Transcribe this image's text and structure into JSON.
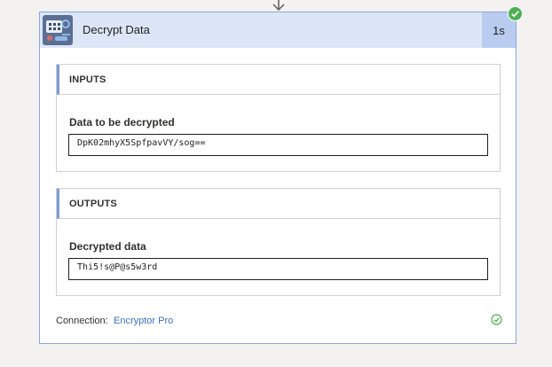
{
  "action": {
    "title": "Decrypt Data",
    "duration": "1s",
    "status": "succeeded"
  },
  "inputs": {
    "section_title": "INPUTS",
    "field_label": "Data to be decrypted",
    "field_value": "DpK02mhyX5SpfpavVY/sog=="
  },
  "outputs": {
    "section_title": "OUTPUTS",
    "field_label": "Decrypted data",
    "field_value": "Thi5!s@P@s5w3rd"
  },
  "connection": {
    "label": "Connection:",
    "name": "Encryptor Pro",
    "status": "connected"
  },
  "icons": {
    "flow_arrow": "arrow-down-icon",
    "app": "encryption-app-icon",
    "success": "check-circle-icon",
    "connection_ok": "check-circle-outline-icon"
  },
  "colors": {
    "header_bg": "#dde6f7",
    "duration_bg": "#b9ccf0",
    "success_green": "#4caf50",
    "link_blue": "#3f6fc5",
    "section_accent": "#7b9bd6"
  }
}
